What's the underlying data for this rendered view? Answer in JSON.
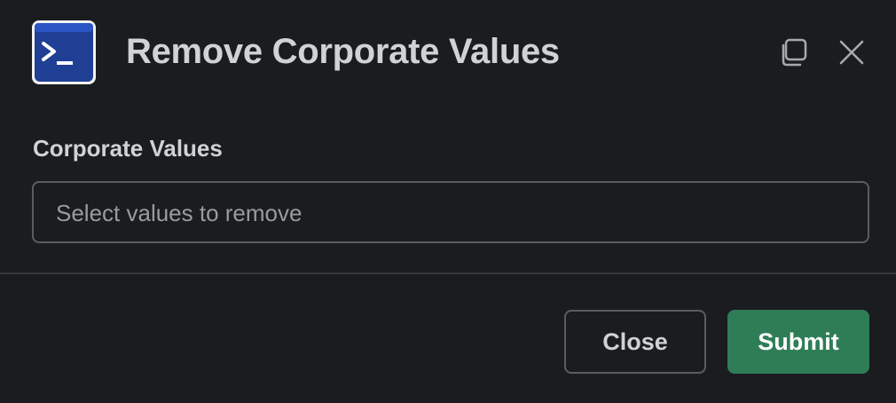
{
  "modal": {
    "title": "Remove Corporate Values",
    "app_icon": "powershell-icon",
    "header_actions": [
      {
        "icon": "popout-icon"
      },
      {
        "icon": "close-icon"
      }
    ]
  },
  "form": {
    "field_label": "Corporate Values",
    "select_placeholder": "Select values to remove"
  },
  "footer": {
    "close_label": "Close",
    "submit_label": "Submit"
  },
  "colors": {
    "background": "#1b1c20",
    "submit_button": "#2e7d57",
    "app_icon_blue": "#1f3f95"
  }
}
